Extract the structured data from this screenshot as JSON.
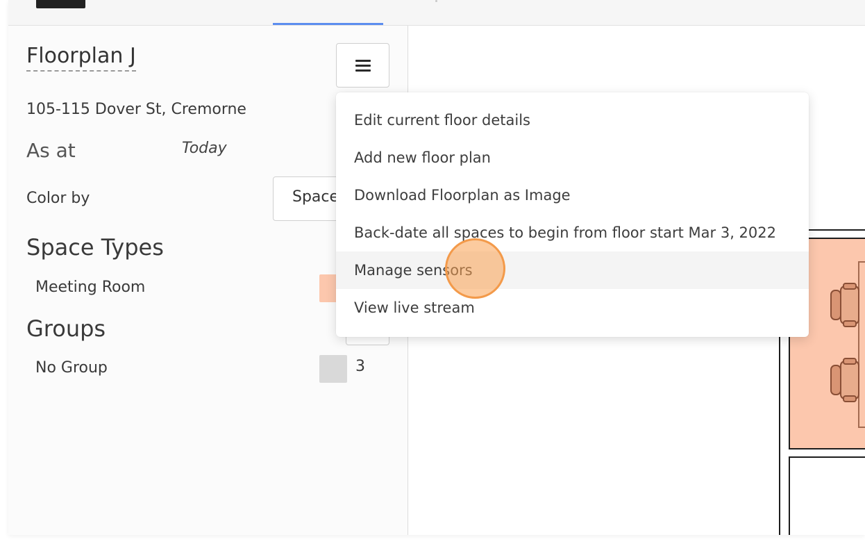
{
  "floor": {
    "title": "Floorplan J",
    "address": "105-115 Dover St, Cremorne",
    "as_at_label": "As at",
    "as_at_value": "Today",
    "color_by_label": "Color by",
    "color_by_value": "Space"
  },
  "space_types": {
    "heading": "Space Types",
    "items": [
      {
        "label": "Meeting Room",
        "color": "#fcc7ad"
      }
    ]
  },
  "groups": {
    "heading": "Groups",
    "items": [
      {
        "label": "No Group",
        "color": "#d9d9d9",
        "count": "3"
      }
    ]
  },
  "menu": {
    "icon": "hamburger-icon",
    "items": [
      {
        "label": "Edit current floor details"
      },
      {
        "label": "Add new floor plan"
      },
      {
        "label": "Download Floorplan as Image"
      },
      {
        "label": "Back-date all spaces to begin from floor start Mar 3, 2022"
      },
      {
        "label": "Manage sensors",
        "highlighted": true
      },
      {
        "label": "View live stream"
      }
    ]
  },
  "colors": {
    "accent_tab": "#5b8def",
    "room_fill": "#fcc7ad",
    "click_highlight": "#f39a4a"
  }
}
